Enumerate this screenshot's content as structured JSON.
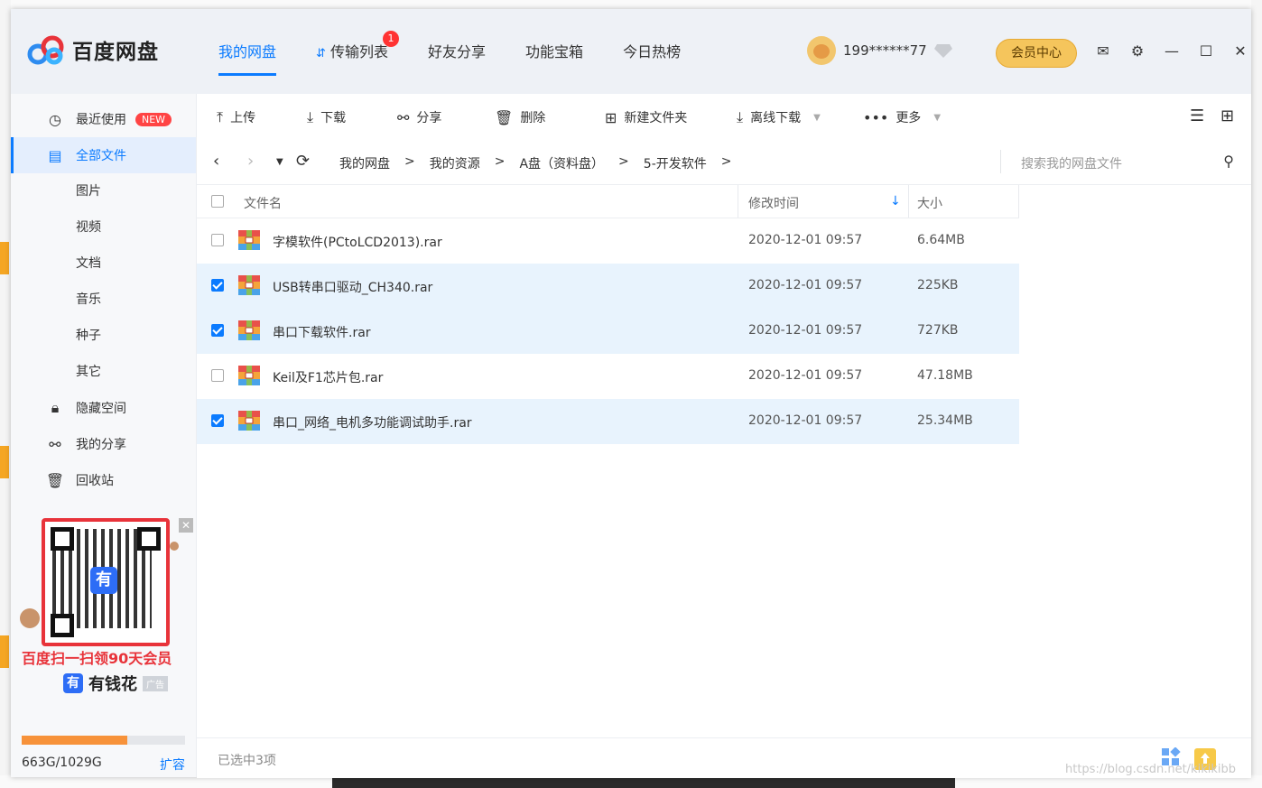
{
  "app": {
    "name": "百度网盘",
    "brand_color": "#0b7bff",
    "accent_color": "#f5c55c"
  },
  "nav": [
    {
      "label": "我的网盘",
      "active": true
    },
    {
      "label": "传输列表",
      "badge": "1"
    },
    {
      "label": "好友分享"
    },
    {
      "label": "功能宝箱"
    },
    {
      "label": "今日热榜"
    }
  ],
  "user": {
    "name": "199******77",
    "vip_button": "会员中心"
  },
  "sidebar": {
    "recent": {
      "label": "最近使用",
      "badge": "NEW"
    },
    "all_files": {
      "label": "全部文件"
    },
    "categories": [
      "图片",
      "视频",
      "文档",
      "音乐",
      "种子",
      "其它"
    ],
    "hidden_space": {
      "label": "隐藏空间"
    },
    "my_share": {
      "label": "我的分享"
    },
    "recycle": {
      "label": "回收站"
    }
  },
  "ad": {
    "line1": "百度扫一扫领90天会员",
    "logo_char": "有",
    "brand": "有钱花",
    "tag": "广告"
  },
  "quota": {
    "used": "663G/1029G",
    "used_fraction": 0.644,
    "expand": "扩容"
  },
  "toolbar": {
    "upload": "上传",
    "download": "下载",
    "share": "分享",
    "delete": "删除",
    "new_folder": "新建文件夹",
    "offline_download": "离线下载",
    "more": "更多"
  },
  "breadcrumb": [
    "我的网盘",
    "我的资源",
    "A盘（资料盘）",
    "5-开发软件"
  ],
  "search": {
    "placeholder": "搜索我的网盘文件"
  },
  "table": {
    "headers": {
      "name": "文件名",
      "modified": "修改时间",
      "size": "大小"
    },
    "rows": [
      {
        "name": "字模软件(PCtoLCD2013).rar",
        "modified": "2020-12-01 09:57",
        "size": "6.64MB",
        "selected": false
      },
      {
        "name": "USB转串口驱动_CH340.rar",
        "modified": "2020-12-01 09:57",
        "size": "225KB",
        "selected": true
      },
      {
        "name": "串口下载软件.rar",
        "modified": "2020-12-01 09:57",
        "size": "727KB",
        "selected": true
      },
      {
        "name": "Keil及F1芯片包.rar",
        "modified": "2020-12-01 09:57",
        "size": "47.18MB",
        "selected": false
      },
      {
        "name": "串口_网络_电机多功能调试助手.rar",
        "modified": "2020-12-01 09:57",
        "size": "25.34MB",
        "selected": true
      }
    ]
  },
  "status": {
    "selected_text": "已选中3项"
  },
  "watermark": "https://blog.csdn.net/kikikibb"
}
